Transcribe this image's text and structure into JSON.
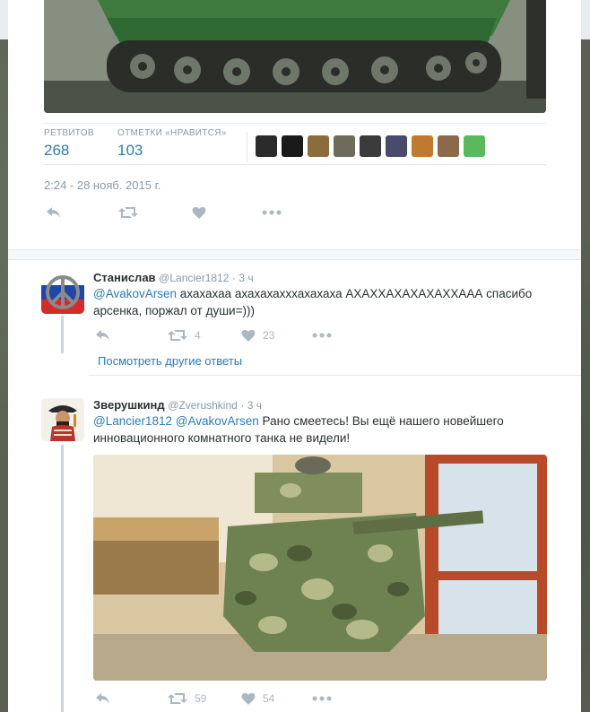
{
  "main_tweet": {
    "stats": {
      "retweets_label": "РЕТВИТОВ",
      "retweets_value": "268",
      "likes_label": "ОТМЕТКИ «НРАВИТСЯ»",
      "likes_value": "103"
    },
    "liker_colors": [
      "#2b2b2b",
      "#1a1a1a",
      "#8a6d3b",
      "#6f6b5a",
      "#3b3b3b",
      "#4a4a6a",
      "#c07a30",
      "#8a6a4a",
      "#5cb85c"
    ],
    "timestamp": "2:24 - 28 нояб. 2015 г."
  },
  "reply1": {
    "name": "Станислав",
    "handle": "@Lancier1812",
    "time": "· 3 ч",
    "mention": "@AvakovArsen",
    "text_line1": "ахахахаа ахахахахххахахаха АХАХХАХАХАХАХХААА спасибо",
    "text_line2": "арсенка, поржал от души=)))",
    "retweets": "4",
    "likes": "23"
  },
  "more_replies": "Посмотреть другие ответы",
  "reply2": {
    "name": "Зверушкинд",
    "handle": "@Zverushkind",
    "time": "· 3 ч",
    "mention1": "@Lancier1812",
    "mention2": "@AvakovArsen",
    "text_line1": "Рано смеетесь! Вы ещё нашего новейшего",
    "text_line2": "инновационного комнатного танка не видели!",
    "retweets": "59",
    "likes": "54"
  },
  "colors": {
    "link": "#2b7bb9",
    "muted": "#8899a6",
    "icon": "#aab8c2",
    "text": "#292f33"
  }
}
